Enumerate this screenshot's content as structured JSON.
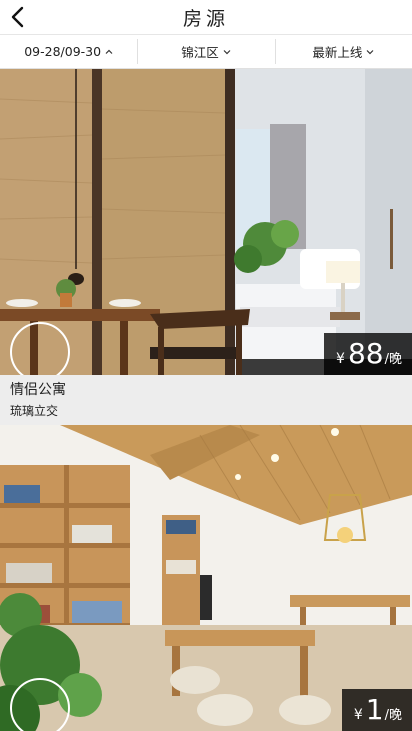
{
  "header": {
    "title": "房源",
    "back_icon": "chevron-left-icon"
  },
  "filters": [
    {
      "label": "09-28/09-30",
      "icon": "chevron-up-icon"
    },
    {
      "label": "锦江区",
      "icon": "chevron-down-icon"
    },
    {
      "label": "最新上线",
      "icon": "chevron-down-icon"
    }
  ],
  "listings": [
    {
      "name": "情侣公寓",
      "location": "琉璃立交",
      "price_currency": "¥",
      "price_amount": "88",
      "price_unit": "/晚"
    },
    {
      "price_currency": "¥",
      "price_amount": "1",
      "price_unit": "/晚"
    }
  ],
  "colors": {
    "price_tag_bg": "#000000",
    "info_bg": "#ededed",
    "text": "#222222"
  }
}
